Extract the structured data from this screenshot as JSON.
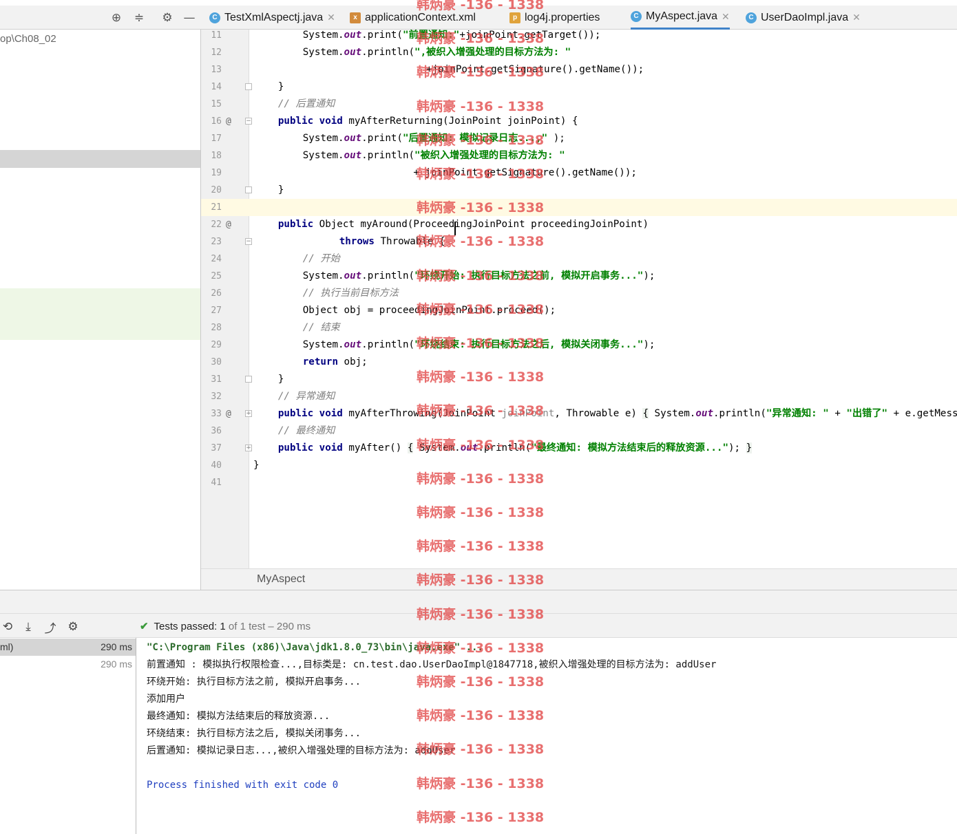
{
  "left_panel": {
    "path_fragment": "op\\Ch08_02",
    "icons": [
      "crosshair-icon",
      "collapse-icon",
      "gear-icon",
      "minimize-icon"
    ]
  },
  "tabs": [
    {
      "label": "TestXmlAspectj.java",
      "icon": "C",
      "type": "java",
      "closable": true,
      "active": false
    },
    {
      "label": "applicationContext.xml",
      "icon": "x",
      "type": "xml",
      "closable": false,
      "active": false
    },
    {
      "label": "log4j.properties",
      "icon": "p",
      "type": "props",
      "closable": false,
      "active": false
    },
    {
      "label": "MyAspect.java",
      "icon": "C",
      "type": "java",
      "closable": true,
      "active": true
    },
    {
      "label": "UserDaoImpl.java",
      "icon": "C",
      "type": "java",
      "closable": true,
      "active": false
    }
  ],
  "editor": {
    "current_line": 21,
    "lines": [
      {
        "num": "11",
        "mark": "",
        "fold": "",
        "indent": 2,
        "html": "System.<span class=\"fld\">out</span>.print(<span class=\"str\">\"前置通知:\"</span>+joinPoint.getTarget());"
      },
      {
        "num": "12",
        "mark": "",
        "fold": "",
        "indent": 2,
        "html": "System.<span class=\"fld\">out</span>.println(<span class=\"str\">\",被织入增强处理的目标方法为: \"</span>"
      },
      {
        "num": "13",
        "mark": "",
        "fold": "",
        "indent": 7,
        "html": "+joinPoint.getSignature().getName());"
      },
      {
        "num": "14",
        "mark": "",
        "fold": "end",
        "indent": 1,
        "html": "}"
      },
      {
        "num": "15",
        "mark": "",
        "fold": "",
        "indent": 1,
        "html": "<span class=\"cmt\">// 后置通知</span>"
      },
      {
        "num": "16",
        "mark": "@",
        "fold": "start",
        "indent": 1,
        "html": "<span class=\"kw\">public void</span> myAfterReturning(JoinPoint joinPoint) {"
      },
      {
        "num": "17",
        "mark": "",
        "fold": "",
        "indent": 2,
        "html": "System.<span class=\"fld\">out</span>.print(<span class=\"str\">\"后置通知: 模拟记录日志...,\"</span> );"
      },
      {
        "num": "18",
        "mark": "",
        "fold": "",
        "indent": 2,
        "html": "System.<span class=\"fld\">out</span>.println(<span class=\"str\">\"被织入增强处理的目标方法为: \"</span>"
      },
      {
        "num": "19",
        "mark": "",
        "fold": "",
        "indent": 6,
        "html": "  + joinPoint.getSignature().getName());"
      },
      {
        "num": "20",
        "mark": "",
        "fold": "end",
        "indent": 1,
        "html": "}"
      },
      {
        "num": "21",
        "mark": "",
        "fold": "",
        "indent": 0,
        "html": ""
      },
      {
        "num": "22",
        "mark": "@",
        "fold": "",
        "indent": 1,
        "html": "<span class=\"kw\">public</span> Object myAround(ProceedingJoinPoint proceedingJoinPoint)"
      },
      {
        "num": "23",
        "mark": "",
        "fold": "start",
        "indent": 3,
        "html": "  <span class=\"kw\">throws</span> Throwable {"
      },
      {
        "num": "24",
        "mark": "",
        "fold": "",
        "indent": 2,
        "html": "<span class=\"cmt\">// 开始</span>"
      },
      {
        "num": "25",
        "mark": "",
        "fold": "",
        "indent": 2,
        "html": "System.<span class=\"fld\">out</span>.println(<span class=\"str\">\"环绕开始: 执行目标方法之前, 模拟开启事务...\"</span>);"
      },
      {
        "num": "26",
        "mark": "",
        "fold": "",
        "indent": 2,
        "html": "<span class=\"cmt\">// 执行当前目标方法</span>"
      },
      {
        "num": "27",
        "mark": "",
        "fold": "",
        "indent": 2,
        "html": "Object obj = proceedingJoinPoint.proceed();"
      },
      {
        "num": "28",
        "mark": "",
        "fold": "",
        "indent": 2,
        "html": "<span class=\"cmt\">// 结束</span>"
      },
      {
        "num": "29",
        "mark": "",
        "fold": "",
        "indent": 2,
        "html": "System.<span class=\"fld\">out</span>.println(<span class=\"str\">\"环绕结束: 执行目标方法之后, 模拟关闭事务...\"</span>);"
      },
      {
        "num": "30",
        "mark": "",
        "fold": "",
        "indent": 2,
        "html": "<span class=\"kw\">return</span> obj;"
      },
      {
        "num": "31",
        "mark": "",
        "fold": "end",
        "indent": 1,
        "html": "}"
      },
      {
        "num": "32",
        "mark": "",
        "fold": "",
        "indent": 1,
        "html": "<span class=\"cmt\">// 异常通知</span>"
      },
      {
        "num": "33",
        "mark": "@",
        "fold": "plus",
        "indent": 1,
        "html": "<span class=\"kw\">public void</span> myAfterThrowing(JoinPoint <span class=\"gray\">joinPoint</span>, Throwable e) <span class=\"fb\">{</span> System.<span class=\"fld\">out</span>.println(<span class=\"str\">\"异常通知: \"</span> + <span class=\"str\">\"出错了\"</span> + e.getMessage()); <span class=\"fb\">}</span>"
      },
      {
        "num": "36",
        "mark": "",
        "fold": "",
        "indent": 1,
        "html": "<span class=\"cmt\">// 最终通知</span>"
      },
      {
        "num": "37",
        "mark": "",
        "fold": "plus",
        "indent": 1,
        "html": "<span class=\"kw\">public void</span> myAfter() <span class=\"fb\">{</span> System.<span class=\"fld\">out</span>.println(<span class=\"str\">\"最终通知: 模拟方法结束后的释放资源...\"</span>); <span class=\"fb\">}</span>"
      },
      {
        "num": "40",
        "mark": "",
        "fold": "",
        "indent": 0,
        "html": "}"
      },
      {
        "num": "41",
        "mark": "",
        "fold": "",
        "indent": 0,
        "html": ""
      }
    ]
  },
  "breadcrumb": {
    "label": "MyAspect"
  },
  "run": {
    "toolbar_icons": [
      "history-icon",
      "import-tests-icon",
      "export-tests-icon",
      "settings-icon"
    ],
    "status_check": "✔",
    "status_label": "Tests passed:",
    "status_count": "1",
    "status_detail": "of 1 test – 290 ms",
    "tree": [
      {
        "name": "ml)",
        "time": "290 ms",
        "selected": true
      },
      {
        "name": "",
        "time": "290 ms",
        "selected": false
      }
    ],
    "console": [
      {
        "text": "\"C:\\Program Files (x86)\\Java\\jdk1.8.0_73\\bin\\java.exe\" ...",
        "kind": "cmd"
      },
      {
        "text": "前置通知 : 模拟执行权限检查...,目标类是: cn.test.dao.UserDaoImpl@1847718,被织入增强处理的目标方法为: addUser",
        "kind": "out"
      },
      {
        "text": "环绕开始: 执行目标方法之前, 模拟开启事务...",
        "kind": "out"
      },
      {
        "text": "添加用户",
        "kind": "out"
      },
      {
        "text": "最终通知: 模拟方法结束后的释放资源...",
        "kind": "out"
      },
      {
        "text": "环绕结束: 执行目标方法之后, 模拟关闭事务...",
        "kind": "out"
      },
      {
        "text": "后置通知: 模拟记录日志...,被织入增强处理的目标方法为: addUser",
        "kind": "out"
      },
      {
        "text": "",
        "kind": "out"
      },
      {
        "text": "Process finished with exit code 0",
        "kind": "fin"
      }
    ]
  },
  "watermark": {
    "text": "韩炳豪 -136 - 1338",
    "count": 25
  },
  "colors": {
    "keyword": "#000080",
    "string": "#008000",
    "comment": "#808080",
    "field": "#660e7a",
    "current_line": "#fffae3",
    "pass": "#3a9a3a"
  }
}
